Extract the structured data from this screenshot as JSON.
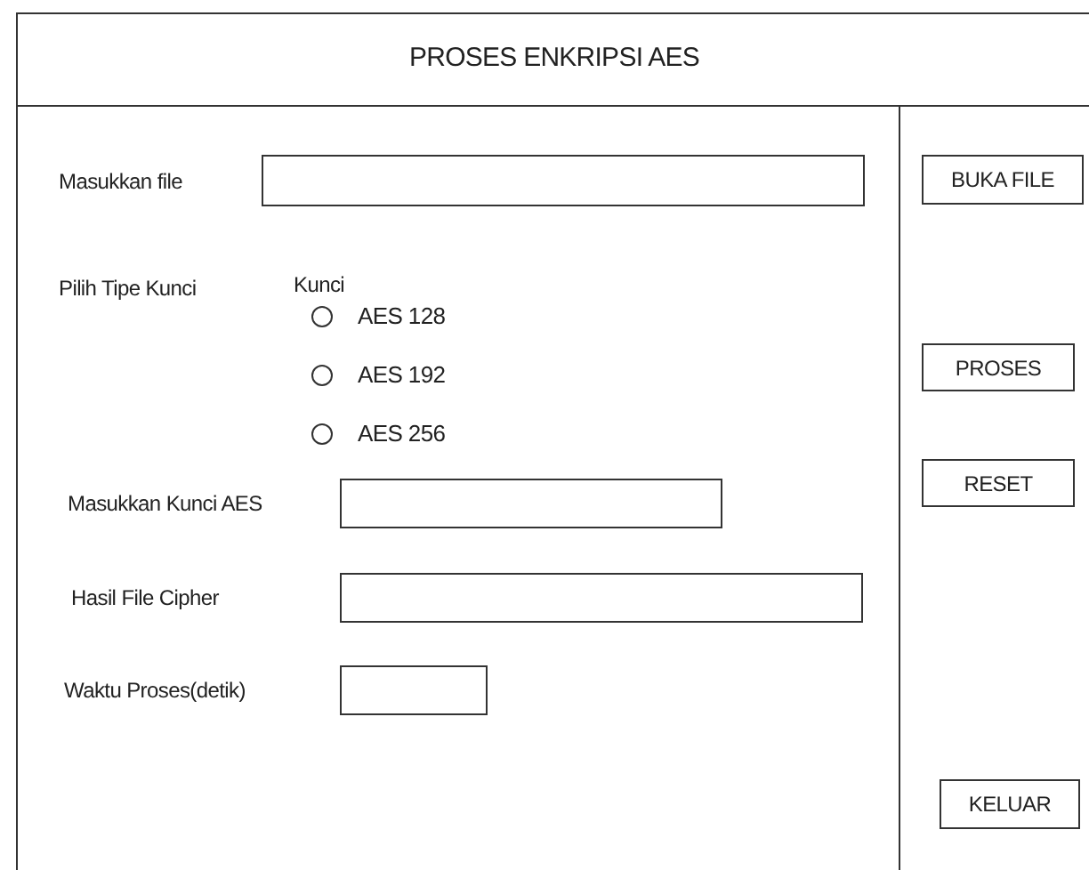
{
  "window": {
    "title": "PROSES ENKRIPSI AES"
  },
  "file_field": {
    "label": "Masukkan file"
  },
  "key_type": {
    "label": "Pilih Tipe Kunci",
    "group_label": "Kunci",
    "options": [
      {
        "label": "AES 128",
        "selected": false
      },
      {
        "label": "AES 192",
        "selected": false
      },
      {
        "label": "AES 256",
        "selected": false
      }
    ]
  },
  "fields": [
    {
      "label": "Masukkan Kunci AES"
    },
    {
      "label": "Hasil File Cipher"
    },
    {
      "label": "Waktu Proses(detik)"
    }
  ],
  "buttons": [
    "BUKA FILE",
    "PROSES",
    "RESET",
    "KELUAR"
  ]
}
